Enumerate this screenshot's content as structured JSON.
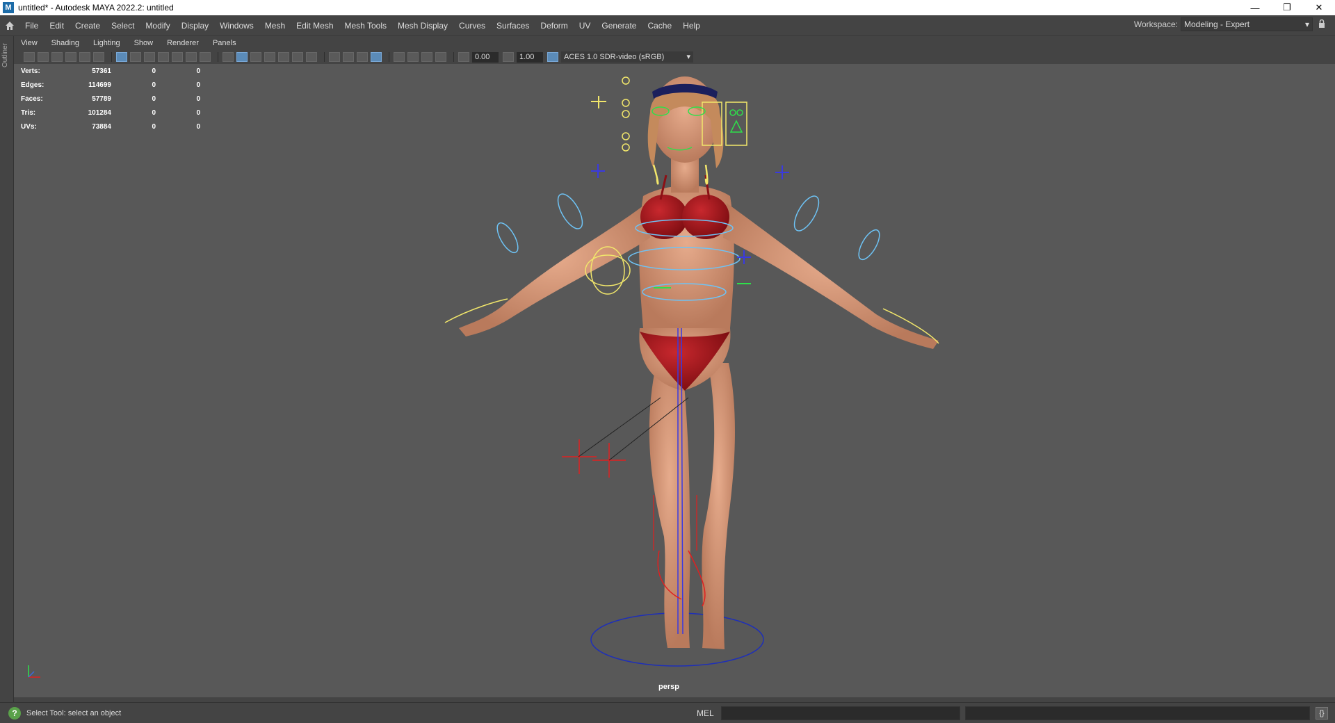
{
  "titlebar": {
    "app_icon": "M",
    "title": "untitled* - Autodesk MAYA 2022.2: untitled",
    "minimize": "—",
    "restore": "❐",
    "close": "✕"
  },
  "menubar": {
    "items": [
      "File",
      "Edit",
      "Create",
      "Select",
      "Modify",
      "Display",
      "Windows",
      "Mesh",
      "Edit Mesh",
      "Mesh Tools",
      "Mesh Display",
      "Curves",
      "Surfaces",
      "Deform",
      "UV",
      "Generate",
      "Cache",
      "Help"
    ],
    "workspace_label": "Workspace:",
    "workspace_value": "Modeling - Expert"
  },
  "outliner": {
    "label": "Outliner"
  },
  "panelmenu": {
    "items": [
      "View",
      "Shading",
      "Lighting",
      "Show",
      "Renderer",
      "Panels"
    ]
  },
  "paneltoolbar": {
    "exposure": "0.00",
    "gamma": "1.00",
    "colorspace": "ACES 1.0 SDR-video (sRGB)"
  },
  "hud": {
    "rows": [
      {
        "label": "Verts:",
        "v1": "57361",
        "v2": "0",
        "v3": "0"
      },
      {
        "label": "Edges:",
        "v1": "114699",
        "v2": "0",
        "v3": "0"
      },
      {
        "label": "Faces:",
        "v1": "57789",
        "v2": "0",
        "v3": "0"
      },
      {
        "label": "Tris:",
        "v1": "101284",
        "v2": "0",
        "v3": "0"
      },
      {
        "label": "UVs:",
        "v1": "73884",
        "v2": "0",
        "v3": "0"
      }
    ]
  },
  "viewport": {
    "camera": "persp",
    "axis_x": "x",
    "axis_y": "y",
    "axis_z": "z"
  },
  "helpline": {
    "message": "Select Tool: select an object",
    "mel_label": "MEL"
  },
  "colors": {
    "skin": "#d89a7a",
    "bikini": "#a8161c",
    "control_yellow": "#f2e76b",
    "control_blue": "#6ec3f5",
    "ik_red": "#e02020"
  }
}
